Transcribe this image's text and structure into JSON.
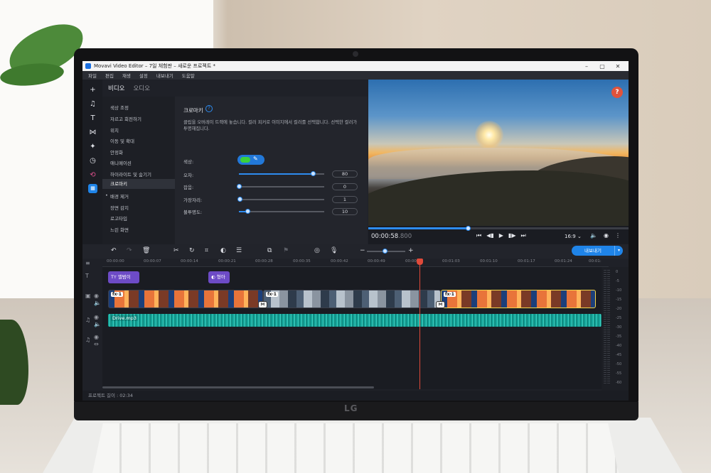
{
  "app": {
    "title": "Movavi Video Editor – 7일 체험판 – 새로운 프로젝트 *",
    "window_controls": [
      "–",
      "▢",
      "✕"
    ]
  },
  "menu": [
    "파일",
    "편집",
    "재생",
    "설정",
    "내보내기",
    "도움말"
  ],
  "tabs": {
    "video": "비디오",
    "audio": "오디오"
  },
  "effects_list": [
    "색상 조정",
    "자르고 회전하기",
    "위치",
    "이동 및 확대",
    "안정화",
    "애니메이션",
    "하이라이트 및 숨기기",
    "크로마키",
    "배경 제거",
    "장면 감지",
    "로고타입",
    "느린 화면"
  ],
  "selected_effect": "크로마키",
  "chroma": {
    "heading": "크로마키",
    "help": "?",
    "description": "클립을 오버레이 트랙에 놓습니다. 컬러 피커로 이미지에서 컬러를 선택합니다. 선택한 컬러가 투명해집니다.",
    "color_label": "색상:",
    "key_color": "#3bd13b",
    "params": [
      {
        "label": "오차:",
        "value": "80",
        "fraction": 0.87
      },
      {
        "label": "잡음:",
        "value": "0",
        "fraction": 0.0
      },
      {
        "label": "가장자리:",
        "value": "1",
        "fraction": 0.01
      },
      {
        "label": "불투명도:",
        "value": "10",
        "fraction": 0.1
      }
    ]
  },
  "preview": {
    "timecode": "00:00:58",
    "timecode_ms": ".800",
    "progress": 0.385,
    "aspect": "16:9 ⌄",
    "help_badge": "?"
  },
  "timeline": {
    "export_label": "내보내기",
    "ruler": [
      "00:00:00",
      "00:00:07",
      "00:00:14",
      "00:00:21",
      "00:00:28",
      "00:00:35",
      "00:00:42",
      "00:00:49",
      "00:00:5",
      "00:01:03",
      "00:01:10",
      "00:01:17",
      "00:01:24",
      "00:01:"
    ],
    "title_clips": [
      "Tт 앨범이",
      "◐ 형아"
    ],
    "fx_label": "fx·1",
    "transition_glyph": "⋈",
    "audio_clip": "Drive.mp3",
    "meter_levels": [
      "0",
      "-5",
      "-10",
      "-15",
      "-20",
      "-25",
      "-30",
      "-35",
      "-40",
      "-45",
      "-50",
      "-55",
      "-60"
    ]
  },
  "status": {
    "project_length": "프로젝트 길이 : 02:34"
  },
  "brand": {
    "logo": "LG"
  }
}
